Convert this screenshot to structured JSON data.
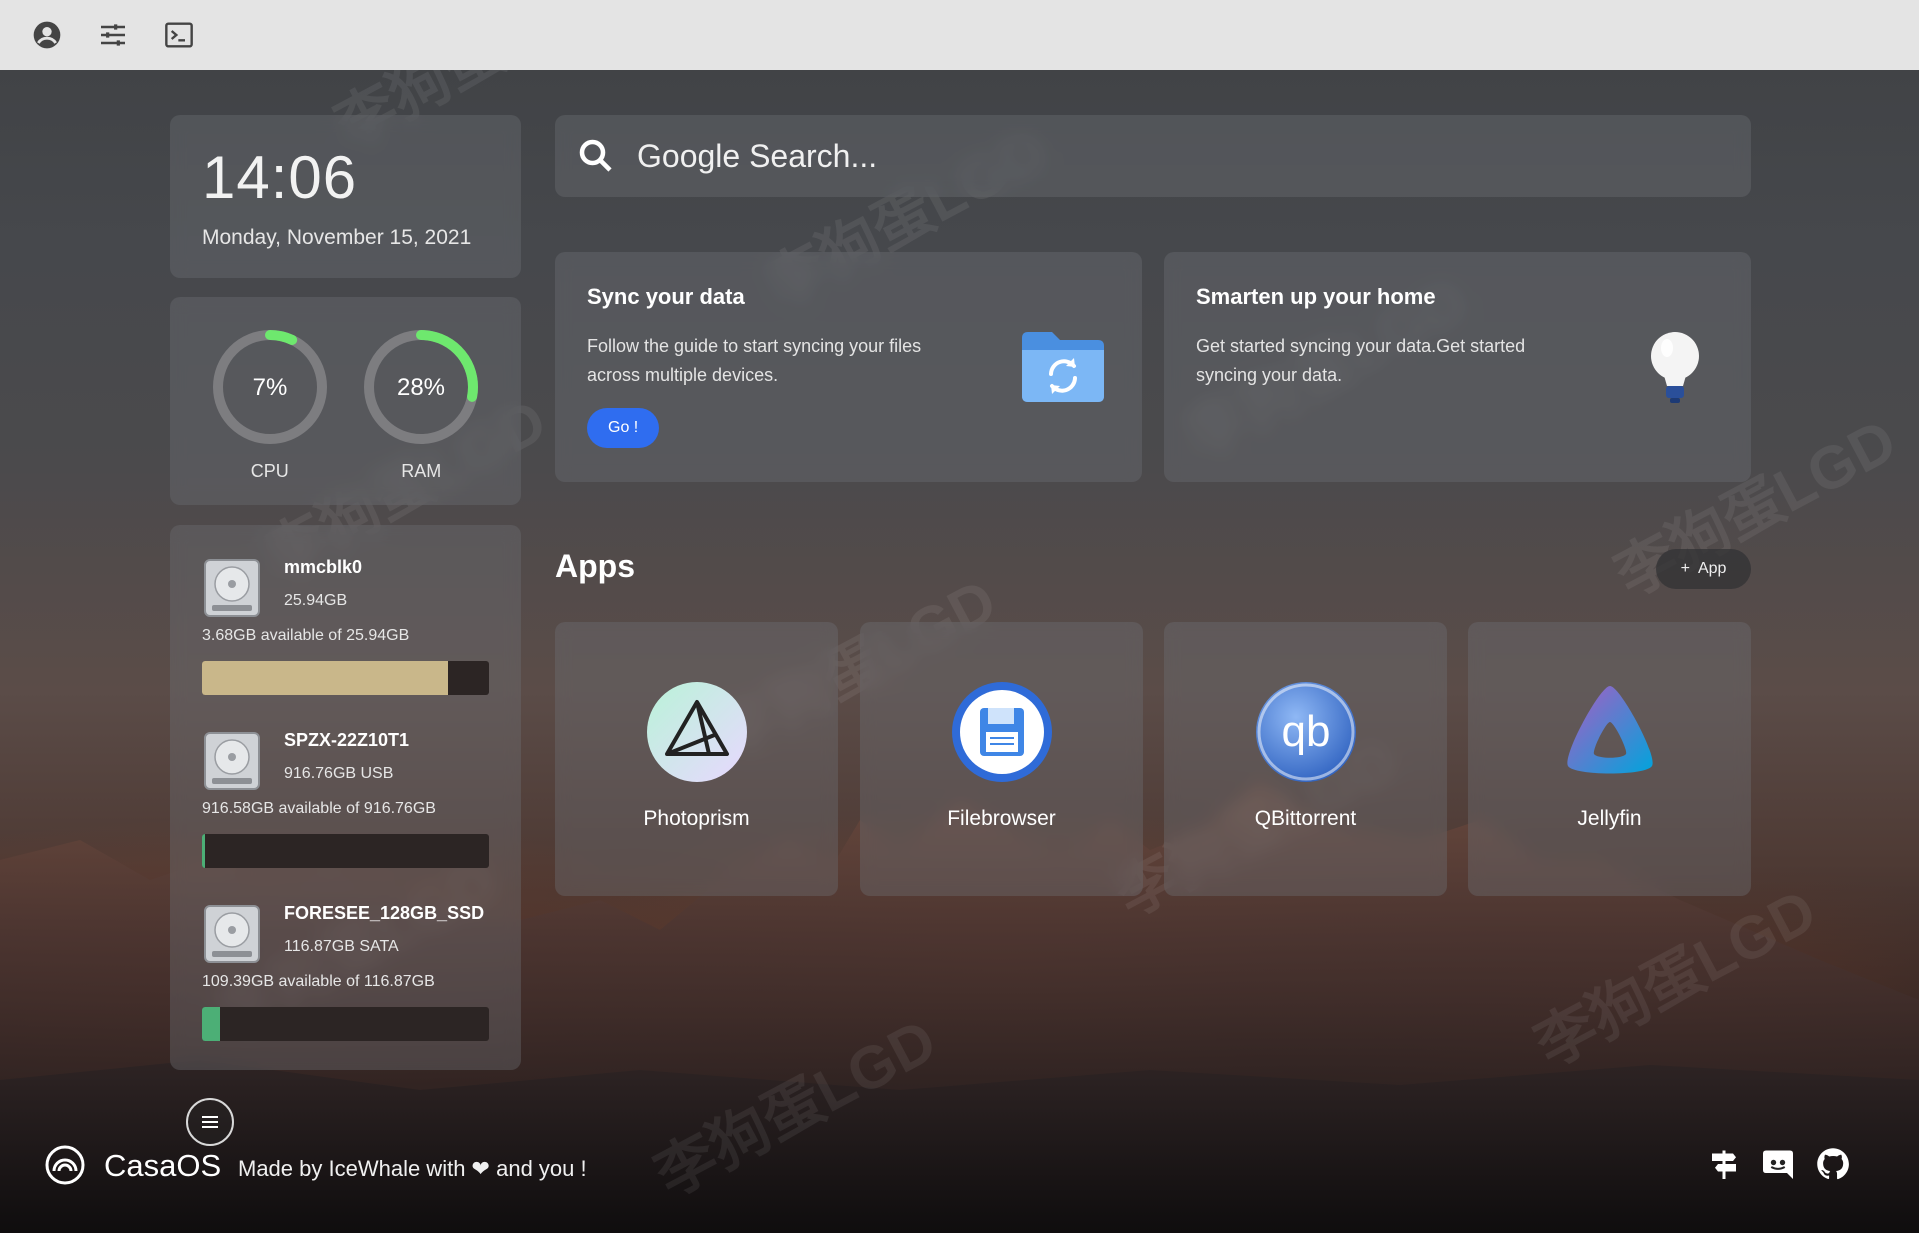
{
  "topbar": {
    "icons": [
      "account-icon",
      "settings-sliders-icon",
      "terminal-icon"
    ]
  },
  "clock": {
    "time": "14:06",
    "date": "Monday, November 15, 2021"
  },
  "usage": {
    "cpu": {
      "label": "CPU",
      "value_text": "7%",
      "percent": 7,
      "color": "#6ee86e"
    },
    "ram": {
      "label": "RAM",
      "value_text": "28%",
      "percent": 28,
      "color": "#6ee86e"
    }
  },
  "disks": [
    {
      "name": "mmcblk0",
      "size": "25.94GB",
      "available": "3.68GB available of 25.94GB",
      "used_fraction": 0.858,
      "color": "#c9b78a"
    },
    {
      "name": "SPZX-22Z10T1",
      "size": "916.76GB USB",
      "available": "916.58GB available of 916.76GB",
      "used_fraction": 0.004,
      "color": "#4caf76"
    },
    {
      "name": "FORESEE_128GB_SSD",
      "size": "116.87GB SATA",
      "available": "109.39GB available of 116.87GB",
      "used_fraction": 0.064,
      "color": "#4caf76"
    }
  ],
  "search": {
    "placeholder": "Google Search..."
  },
  "cards": {
    "sync": {
      "title": "Sync your data",
      "description": "Follow the guide to start syncing your files across multiple devices.",
      "button": "Go !"
    },
    "home": {
      "title": "Smarten up your home",
      "description": "Get started syncing your data.Get started syncing your data."
    }
  },
  "apps": {
    "title": "Apps",
    "add_label": "App",
    "items": [
      {
        "name": "Photoprism",
        "icon": "photoprism-icon"
      },
      {
        "name": "Filebrowser",
        "icon": "filebrowser-icon"
      },
      {
        "name": "QBittorrent",
        "icon": "qbittorrent-icon"
      },
      {
        "name": "Jellyfin",
        "icon": "jellyfin-icon"
      }
    ]
  },
  "footer": {
    "brand": "CasaOS",
    "made_by": "Made by IceWhale with ❤ and you !",
    "social": [
      "signpost-icon",
      "discord-icon",
      "github-icon"
    ]
  },
  "watermark": "李狗蛋LGD"
}
